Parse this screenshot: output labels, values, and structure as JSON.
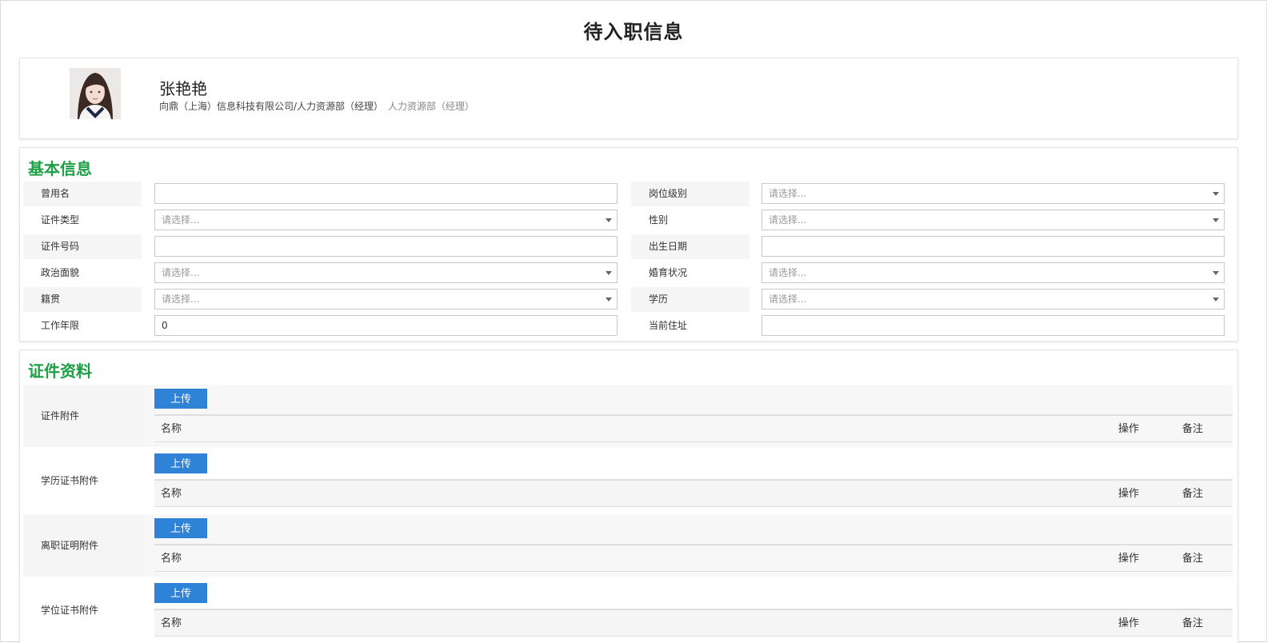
{
  "page": {
    "title": "待入职信息"
  },
  "profile": {
    "name": "张艳艳",
    "org": "向鼎（上海）信息科技有限公司/人力资源部（经理）",
    "role": "人力资源部（经理）"
  },
  "basic": {
    "title": "基本信息",
    "rows": [
      {
        "label1": "曾用名",
        "value1": "",
        "label2": "岗位级别",
        "value2": "请选择..."
      },
      {
        "label1": "证件类型",
        "value1": "请选择...",
        "label2": "性别",
        "value2": "请选择..."
      },
      {
        "label1": "证件号码",
        "value1": "",
        "label2": "出生日期",
        "value2": ""
      },
      {
        "label1": "政治面貌",
        "value1": "请选择...",
        "label2": "婚育状况",
        "value2": "请选择..."
      },
      {
        "label1": "籍贯",
        "value1": "请选择...",
        "label2": "学历",
        "value2": "请选择..."
      },
      {
        "label1": "工作年限",
        "value1": "0",
        "label2": "当前住址",
        "value2": ""
      }
    ]
  },
  "docs": {
    "title": "证件资料",
    "upload_label": "上传",
    "columns": {
      "name": "名称",
      "operation": "操作",
      "note": "备注"
    },
    "items": [
      {
        "label": "证件附件"
      },
      {
        "label": "学历证书附件"
      },
      {
        "label": "离职证明附件"
      },
      {
        "label": "学位证书附件"
      }
    ]
  }
}
